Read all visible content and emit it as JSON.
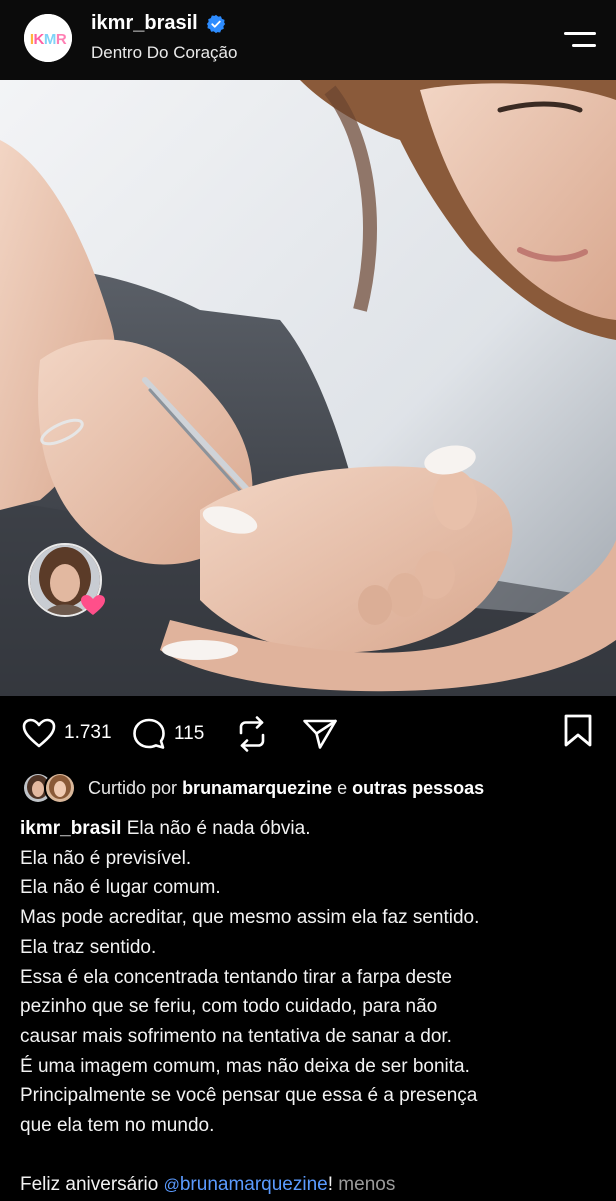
{
  "header": {
    "avatar_text": "IKMR",
    "username": "ikmr_brasil",
    "subtitle": "Dentro Do Coração"
  },
  "post": {
    "likes_count": "1.731",
    "comments_count": "115"
  },
  "liked_by": {
    "prefix": "Curtido por",
    "user": "brunamarquezine",
    "conjunction": "e",
    "others": "outras pessoas"
  },
  "caption": {
    "author": "ikmr_brasil",
    "first_line": "Ela não é nada óbvia.",
    "lines": [
      "Ela não é previsível.",
      "Ela não é lugar comum.",
      "Mas pode acreditar, que mesmo assim ela faz sentido.",
      "Ela traz sentido.",
      "Essa é ela concentrada tentando tirar a farpa deste",
      "pezinho que se feriu, com todo cuidado, para não",
      "causar mais sofrimento na tentativa de sanar a dor.",
      "É uma imagem comum, mas não deixa de ser bonita.",
      "Principalmente se você pensar que essa é a presença",
      "que ela tem no mundo."
    ],
    "closing_prefix": "Feliz aniversário",
    "mention_handle": "@brunamarquezine",
    "closing_suffix": "!",
    "less_label": "menos"
  },
  "colors": {
    "background": "#000000",
    "mention": "#5b9bff",
    "verified": "#2d8cff",
    "heart_badge": "#ff4f8a"
  },
  "icons": [
    "heart-icon",
    "comment-icon",
    "repost-icon",
    "share-icon",
    "bookmark-icon",
    "verified-icon",
    "menu-icon"
  ]
}
